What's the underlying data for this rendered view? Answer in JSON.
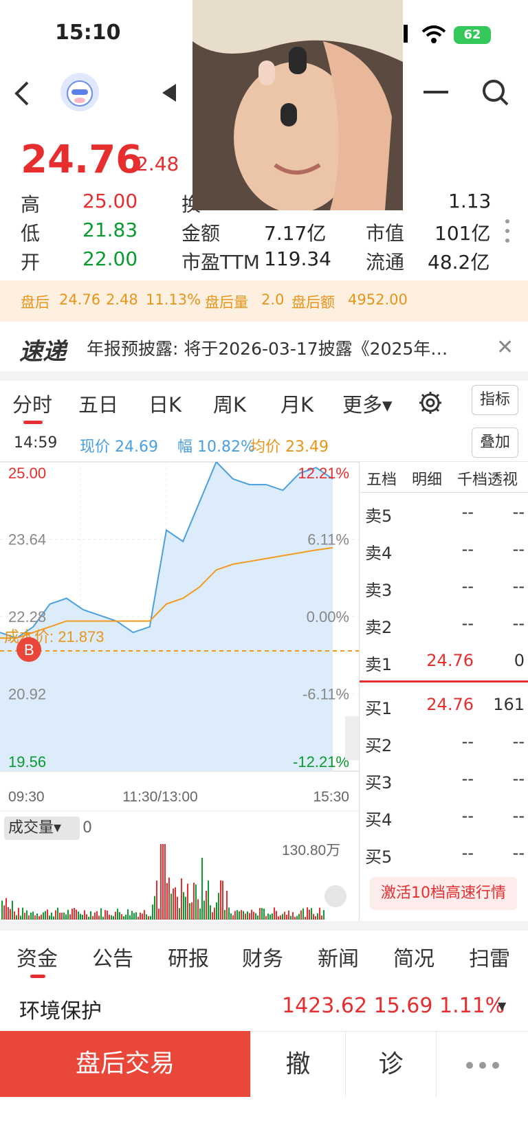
{
  "status": {
    "time": "15:10",
    "battery": "62"
  },
  "quote": {
    "price": "24.76",
    "change": "2.48",
    "high_label": "高",
    "high": "25.00",
    "low_label": "低",
    "low": "21.83",
    "open_label": "开",
    "open": "22.00",
    "turnover_label": "换",
    "ratio_val": "1.13",
    "amount_label": "金额",
    "amount": "7.17亿",
    "pe_label": "市盈TTM",
    "pe": "119.34",
    "mcap_label": "市值",
    "mcap": "101亿",
    "float_label": "流通",
    "float": "48.2亿"
  },
  "after_hours": {
    "label": "盘后",
    "price": "24.76",
    "change": "2.48",
    "pct": "11.13%",
    "vol_label": "盘后量",
    "vol": "2.0",
    "amt_label": "盘后额",
    "amt": "4952.00"
  },
  "ticker": {
    "logo": "速递",
    "text": "年报预披露: 将于2026-03-17披露《2025年…"
  },
  "chart_tabs": [
    "分时",
    "五日",
    "日K",
    "周K",
    "月K",
    "更多▾"
  ],
  "chart_buttons": {
    "indicator": "指标",
    "overlay": "叠加"
  },
  "info_row": {
    "time": "14:59",
    "now": "现价 24.69",
    "amp": "幅 10.82%",
    "avg": "均价 23.49"
  },
  "chart_labels": {
    "y_left": [
      "25.00",
      "23.64",
      "22.28",
      "20.92",
      "19.56"
    ],
    "y_right": [
      "12.21%",
      "6.11%",
      "0.00%",
      "-6.11%",
      "-12.21%"
    ],
    "x": [
      "09:30",
      "11:30/13:00",
      "15:30"
    ],
    "cost_line": "成本价: 21.873",
    "buy_marker": "B",
    "volume_label": "成交量▾",
    "volume_val": "0",
    "volume_max": "130.80万"
  },
  "chart_data": {
    "type": "line",
    "title": "",
    "ylim": [
      19.56,
      25.0
    ],
    "x_ticks": [
      "09:30",
      "11:30/13:00",
      "15:30"
    ],
    "series": [
      {
        "values": [
          22.0,
          21.9,
          22.1,
          22.5,
          22.6,
          22.4,
          22.3,
          22.2,
          22.0,
          22.1,
          23.8,
          23.6,
          24.3,
          25.0,
          24.7,
          24.6,
          24.6,
          24.5,
          24.8,
          24.9,
          24.7
        ]
      },
      {
        "values": [
          21.9,
          21.9,
          22.0,
          22.1,
          22.2,
          22.2,
          22.2,
          22.2,
          22.2,
          22.2,
          22.5,
          22.6,
          22.8,
          23.1,
          23.2,
          23.25,
          23.3,
          23.35,
          23.4,
          23.45,
          23.49
        ]
      }
    ],
    "colors": {
      "price": "#4a9fe0",
      "avg": "#f39a1e",
      "cost": "#f39a1e"
    }
  },
  "order_book": {
    "tabs": [
      "五档",
      "明细",
      "千档透视"
    ],
    "asks": [
      {
        "label": "卖5",
        "price": "--",
        "vol": "--"
      },
      {
        "label": "卖4",
        "price": "--",
        "vol": "--"
      },
      {
        "label": "卖3",
        "price": "--",
        "vol": "--"
      },
      {
        "label": "卖2",
        "price": "--",
        "vol": "--"
      },
      {
        "label": "卖1",
        "price": "24.76",
        "vol": "0"
      }
    ],
    "bids": [
      {
        "label": "买1",
        "price": "24.76",
        "vol": "161"
      },
      {
        "label": "买2",
        "price": "--",
        "vol": "--"
      },
      {
        "label": "买3",
        "price": "--",
        "vol": "--"
      },
      {
        "label": "买4",
        "price": "--",
        "vol": "--"
      },
      {
        "label": "买5",
        "price": "--",
        "vol": "--"
      }
    ],
    "activate": "激活10档高速行情"
  },
  "bottom_tabs": [
    "资金",
    "公告",
    "研报",
    "财务",
    "新闻",
    "简况",
    "扫雷"
  ],
  "sector": {
    "name": "环境保护",
    "values": "1423.62  15.69  1.11%"
  },
  "actions": {
    "trade": "盘后交易",
    "cancel": "撤",
    "diagnose": "诊"
  }
}
